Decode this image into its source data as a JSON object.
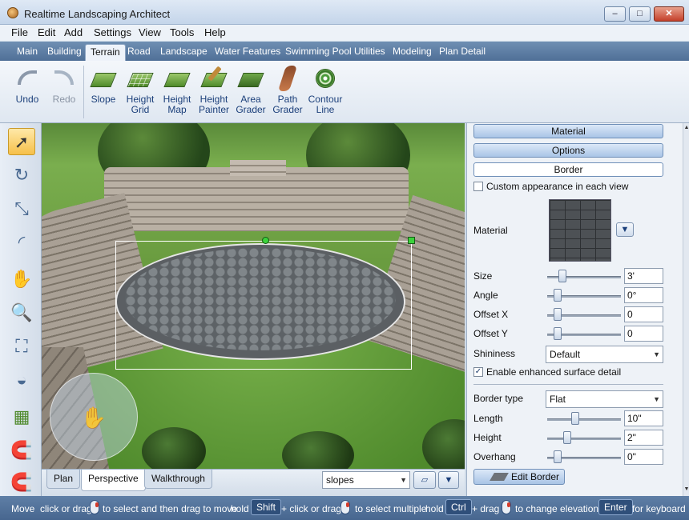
{
  "window": {
    "title": "Realtime Landscaping Architect",
    "min": "–",
    "max": "□",
    "close": "✕"
  },
  "menu": [
    "File",
    "Edit",
    "Add",
    "Settings",
    "View",
    "Tools",
    "Help"
  ],
  "tabs": [
    "Main",
    "Building",
    "Terrain",
    "Road",
    "Landscape",
    "Water Features",
    "Swimming Pool",
    "Utilities",
    "Modeling",
    "Plan Detail"
  ],
  "active_tab": "Terrain",
  "ribbon": {
    "undo": "Undo",
    "redo": "Redo",
    "slope": "Slope",
    "height_grid": [
      "Height",
      "Grid"
    ],
    "height_map": [
      "Height",
      "Map"
    ],
    "height_painter": [
      "Height",
      "Painter"
    ],
    "area_grader": [
      "Area",
      "Grader"
    ],
    "path_grader": [
      "Path",
      "Grader"
    ],
    "contour_line": [
      "Contour",
      "Line"
    ]
  },
  "left_tools": {
    "select": "➚",
    "rotate": "↻",
    "resize": "⤡",
    "arc": "◜",
    "pan": "✋",
    "zoom": "🔍",
    "zoom_box": "⛶",
    "orbit": "◒",
    "grid": "▦",
    "snap": "🧲",
    "magnet": "🧲"
  },
  "view": {
    "nav_hand": "✋"
  },
  "view_tabs": [
    "Plan",
    "Perspective",
    "Walkthrough"
  ],
  "active_view_tab": "Perspective",
  "layer_select": {
    "value": "slopes",
    "arrow": "▼"
  },
  "view_buttons": {
    "layers": "▱",
    "menu": "▼"
  },
  "panel": {
    "material_btn": "Material",
    "options_btn": "Options",
    "border_btn": "Border",
    "custom_appearance": "Custom appearance in each view",
    "material_label": "Material",
    "material_dropdown": "▼",
    "size_label": "Size",
    "size_value": "3'",
    "angle_label": "Angle",
    "angle_value": "0°",
    "offset_x_label": "Offset X",
    "offset_x_value": "0",
    "offset_y_label": "Offset Y",
    "offset_y_value": "0",
    "shininess_label": "Shininess",
    "shininess_value": "Default",
    "enhanced_detail": "Enable enhanced surface detail",
    "check_mark": "✓",
    "border_type_label": "Border type",
    "border_type_value": "Flat",
    "length_label": "Length",
    "length_value": "10\"",
    "height_label": "Height",
    "height_value": "2\"",
    "overhang_label": "Overhang",
    "overhang_value": "0\"",
    "edit_border": "Edit Border",
    "select_arrow": "▼",
    "scroll_up": "▲",
    "scroll_down": "▼"
  },
  "status": {
    "move": "Move",
    "t1": "click or drag",
    "t2": "to select and then drag to move",
    "hold1": "hold",
    "shift": "Shift",
    "t3": "+ click or drag",
    "t4": "to select multiple",
    "hold2": "hold",
    "ctrl": "Ctrl",
    "t5": "+ drag",
    "t6": "to change elevation",
    "enter": "Enter",
    "t7": "for keyboard"
  }
}
